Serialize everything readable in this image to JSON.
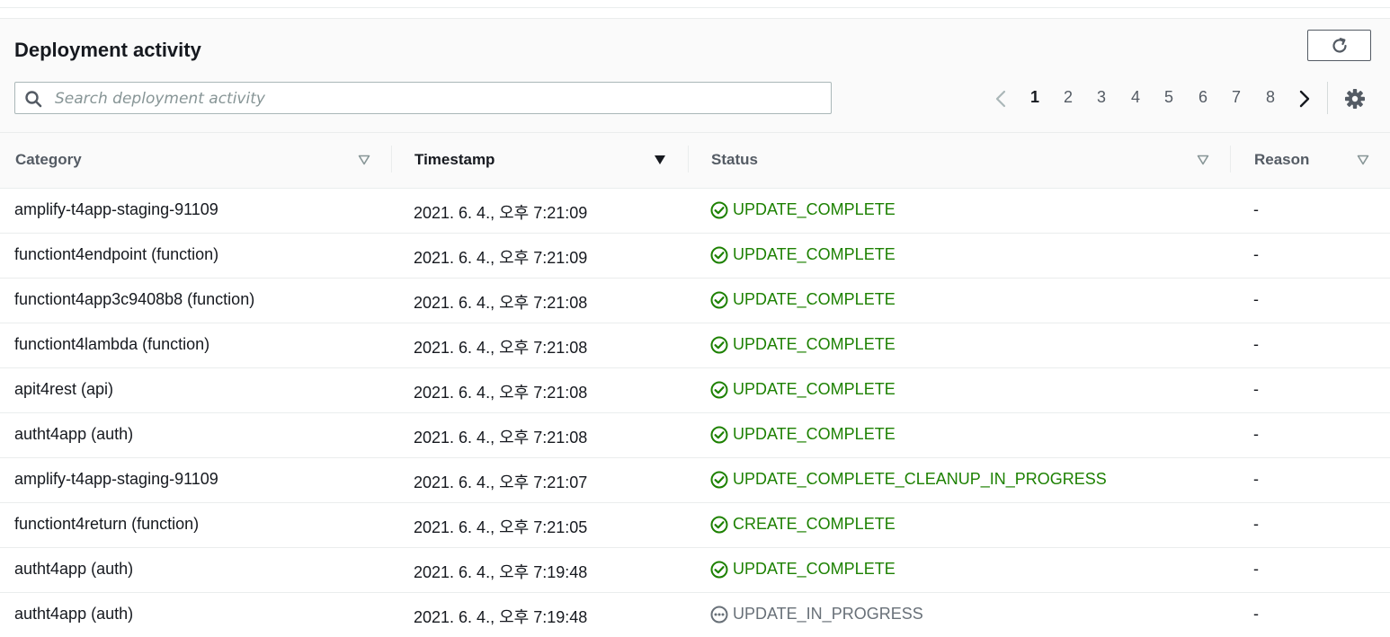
{
  "header": {
    "title": "Deployment activity",
    "search_placeholder": "Search deployment activity"
  },
  "pagination": {
    "pages": [
      "1",
      "2",
      "3",
      "4",
      "5",
      "6",
      "7",
      "8"
    ],
    "current": "1"
  },
  "colors": {
    "success": "#1d8102",
    "in_progress": "#687078",
    "accent": "#16191f"
  },
  "table": {
    "columns": [
      {
        "label": "Category",
        "sorted": false
      },
      {
        "label": "Timestamp",
        "sorted": true
      },
      {
        "label": "Status",
        "sorted": false
      },
      {
        "label": "Reason",
        "sorted": false
      }
    ],
    "rows": [
      {
        "category": "amplify-t4app-staging-91109",
        "timestamp": "2021. 6. 4., 오후 7:21:09",
        "status": "UPDATE_COMPLETE",
        "state": "success",
        "reason": "-"
      },
      {
        "category": "functiont4endpoint (function)",
        "timestamp": "2021. 6. 4., 오후 7:21:09",
        "status": "UPDATE_COMPLETE",
        "state": "success",
        "reason": "-"
      },
      {
        "category": "functiont4app3c9408b8 (function)",
        "timestamp": "2021. 6. 4., 오후 7:21:08",
        "status": "UPDATE_COMPLETE",
        "state": "success",
        "reason": "-"
      },
      {
        "category": "functiont4lambda (function)",
        "timestamp": "2021. 6. 4., 오후 7:21:08",
        "status": "UPDATE_COMPLETE",
        "state": "success",
        "reason": "-"
      },
      {
        "category": "apit4rest (api)",
        "timestamp": "2021. 6. 4., 오후 7:21:08",
        "status": "UPDATE_COMPLETE",
        "state": "success",
        "reason": "-"
      },
      {
        "category": "autht4app (auth)",
        "timestamp": "2021. 6. 4., 오후 7:21:08",
        "status": "UPDATE_COMPLETE",
        "state": "success",
        "reason": "-"
      },
      {
        "category": "amplify-t4app-staging-91109",
        "timestamp": "2021. 6. 4., 오후 7:21:07",
        "status": "UPDATE_COMPLETE_CLEANUP_IN_PROGRESS",
        "state": "success",
        "reason": "-"
      },
      {
        "category": "functiont4return (function)",
        "timestamp": "2021. 6. 4., 오후 7:21:05",
        "status": "CREATE_COMPLETE",
        "state": "success",
        "reason": "-"
      },
      {
        "category": "autht4app (auth)",
        "timestamp": "2021. 6. 4., 오후 7:19:48",
        "status": "UPDATE_COMPLETE",
        "state": "success",
        "reason": "-"
      },
      {
        "category": "autht4app (auth)",
        "timestamp": "2021. 6. 4., 오후 7:19:48",
        "status": "UPDATE_IN_PROGRESS",
        "state": "in_progress",
        "reason": "-"
      }
    ]
  }
}
